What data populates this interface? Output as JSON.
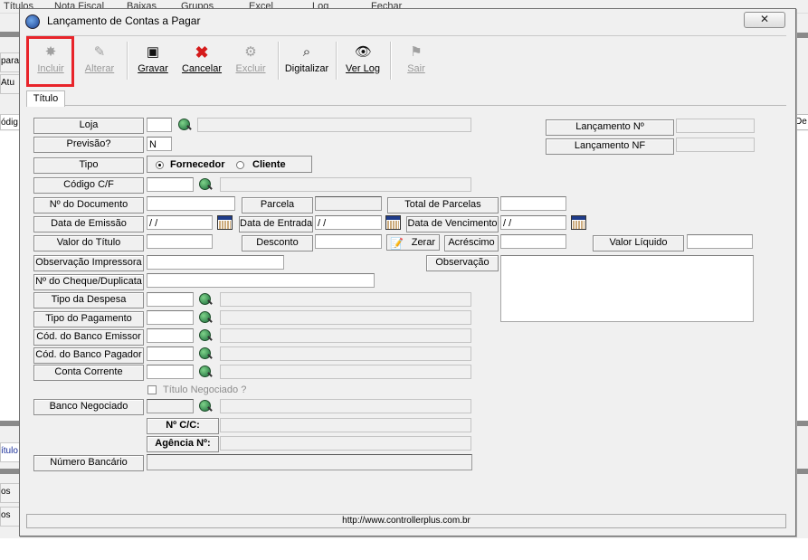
{
  "background": {
    "menu": [
      "Títulos",
      "Nota Fiscal",
      "Baixas",
      "Grupos",
      "Excel",
      "Log",
      "Fechar"
    ],
    "left_snippets": [
      "para",
      "Atu",
      "ódig",
      "ítulo",
      "os",
      "os"
    ],
    "right_snippets": [
      "De"
    ]
  },
  "dialog": {
    "title": "Lançamento de Contas a Pagar",
    "close_glyph": "✕"
  },
  "toolbar": [
    {
      "label": "Incluir",
      "icon": "insert-icon",
      "enabled": false
    },
    {
      "label": "Alterar",
      "icon": "edit-icon",
      "enabled": false
    },
    {
      "label": "Gravar",
      "icon": "save-icon",
      "enabled": true
    },
    {
      "label": "Cancelar",
      "icon": "cancel-icon",
      "enabled": true
    },
    {
      "label": "Excluir",
      "icon": "delete-icon",
      "enabled": false
    },
    {
      "label": "Digitalizar",
      "icon": "scan-icon",
      "enabled": true
    },
    {
      "label": "Ver Log",
      "icon": "eye-icon",
      "enabled": true
    },
    {
      "label": "Sair",
      "icon": "exit-icon",
      "enabled": false
    }
  ],
  "tab": "Título",
  "form": {
    "loja": "Loja",
    "previsao": "Previsão?",
    "previsao_value": "N",
    "tipo": "Tipo",
    "tipo_options": [
      "Fornecedor",
      "Cliente"
    ],
    "tipo_selected": "Fornecedor",
    "codigo_cf": "Código C/F",
    "n_documento": "Nº do Documento",
    "parcela": "Parcela",
    "total_parcelas": "Total de Parcelas",
    "data_emissao": "Data de Emissão",
    "data_emissao_value": " / /",
    "data_entrada": "Data de Entrada",
    "data_entrada_value": " / /",
    "data_vencimento": "Data de Vencimento",
    "data_vencimento_value": " / /",
    "valor_titulo": "Valor do Título",
    "desconto": "Desconto",
    "zerar": "Zerar",
    "acrescimo": "Acréscimo",
    "valor_liquido": "Valor Líquido",
    "obs_impressora": "Observação Impressora",
    "observacao": "Observação",
    "n_cheque": "Nº do Cheque/Duplicata",
    "tipo_despesa": "Tipo da Despesa",
    "tipo_pagamento": "Tipo do Pagamento",
    "cod_banco_emissor": "Cód. do Banco Emissor",
    "cod_banco_pagador": "Cód. do Banco Pagador",
    "conta_corrente": "Conta Corrente",
    "titulo_negociado": "Título Negociado ?",
    "banco_negociado": "Banco Negociado",
    "n_cc": "Nº C/C:",
    "agencia": "Agência Nº:",
    "numero_bancario": "Número Bancário",
    "lancamento_n": "Lançamento Nº",
    "lancamento_nf": "Lançamento NF"
  },
  "status": {
    "url": "http://www.controllerplus.com.br"
  },
  "colors": {
    "highlight": "#e8242a"
  }
}
